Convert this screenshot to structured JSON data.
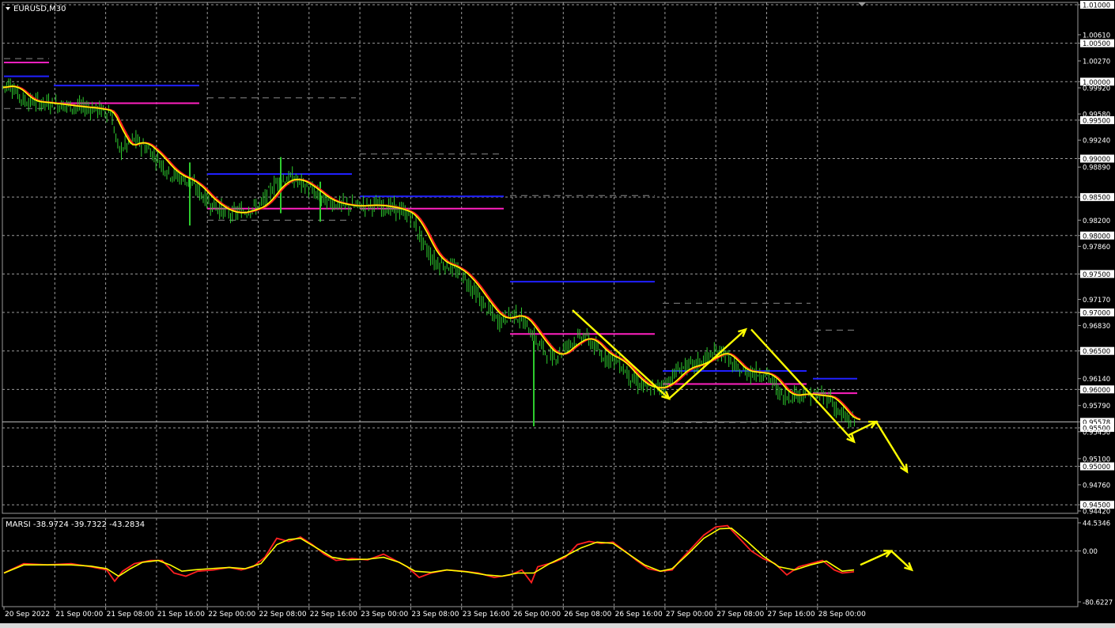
{
  "header": {
    "symbol_label": "EURUSD,M30"
  },
  "indicator": {
    "label": "MARSI -38.9724 -39.7322 -43.2834"
  },
  "colors": {
    "background": "#000000",
    "grid": "#9a9a9a",
    "candle": "#2ecc2e",
    "ma_fast": "#ff2020",
    "ma_slow": "#ffff00",
    "level_blue": "#2020ff",
    "level_magenta": "#ff20c0",
    "arrow": "#ffff00",
    "text": "#ffffff"
  },
  "chart_data": [
    {
      "type": "candlestick",
      "name": "EURUSD,M30",
      "ylim": [
        0.9442,
        1.01
      ],
      "x_ticks": [
        "20 Sep 2022",
        "21 Sep 00:00",
        "21 Sep 08:00",
        "21 Sep 16:00",
        "22 Sep 00:00",
        "22 Sep 08:00",
        "22 Sep 16:00",
        "23 Sep 00:00",
        "23 Sep 08:00",
        "23 Sep 16:00",
        "26 Sep 00:00",
        "26 Sep 08:00",
        "26 Sep 16:00",
        "27 Sep 00:00",
        "27 Sep 08:00",
        "27 Sep 16:00",
        "28 Sep 00:00"
      ],
      "y_ticks": [
        "1.01000",
        "1.00610",
        "1.00500",
        "1.00270",
        "1.00000",
        "0.99920",
        "0.99580",
        "0.99500",
        "0.99240",
        "0.99000",
        "0.98890",
        "0.98500",
        "0.98200",
        "0.98000",
        "0.97860",
        "0.97500",
        "0.97170",
        "0.97000",
        "0.96830",
        "0.96500",
        "0.96140",
        "0.96000",
        "0.95790",
        "0.95578",
        "0.95500",
        "0.95450",
        "0.95100",
        "0.95000",
        "0.94760",
        "0.94500",
        "0.94420"
      ],
      "current_price": 0.95578,
      "grid": true,
      "price_path": [
        [
          0,
          0.999
        ],
        [
          12,
          0.9998
        ],
        [
          30,
          0.9975
        ],
        [
          60,
          0.9972
        ],
        [
          90,
          0.9968
        ],
        [
          120,
          0.9965
        ],
        [
          140,
          0.996
        ],
        [
          150,
          0.991
        ],
        [
          170,
          0.9925
        ],
        [
          190,
          0.991
        ],
        [
          215,
          0.988
        ],
        [
          240,
          0.987
        ],
        [
          265,
          0.9842
        ],
        [
          290,
          0.9828
        ],
        [
          310,
          0.9832
        ],
        [
          330,
          0.984
        ],
        [
          350,
          0.987
        ],
        [
          370,
          0.9875
        ],
        [
          390,
          0.9862
        ],
        [
          410,
          0.9845
        ],
        [
          440,
          0.9838
        ],
        [
          470,
          0.984
        ],
        [
          500,
          0.9835
        ],
        [
          520,
          0.9825
        ],
        [
          535,
          0.979
        ],
        [
          550,
          0.9765
        ],
        [
          570,
          0.976
        ],
        [
          590,
          0.9742
        ],
        [
          610,
          0.9712
        ],
        [
          630,
          0.9688
        ],
        [
          650,
          0.97
        ],
        [
          665,
          0.9685
        ],
        [
          680,
          0.966
        ],
        [
          700,
          0.964
        ],
        [
          720,
          0.966
        ],
        [
          740,
          0.967
        ],
        [
          760,
          0.9645
        ],
        [
          780,
          0.9638
        ],
        [
          800,
          0.9612
        ],
        [
          820,
          0.96
        ],
        [
          840,
          0.9605
        ],
        [
          860,
          0.9628
        ],
        [
          880,
          0.9632
        ],
        [
          900,
          0.9645
        ],
        [
          915,
          0.965
        ],
        [
          930,
          0.9625
        ],
        [
          950,
          0.9622
        ],
        [
          970,
          0.962
        ],
        [
          990,
          0.959
        ],
        [
          1010,
          0.9595
        ],
        [
          1030,
          0.9592
        ],
        [
          1050,
          0.959
        ],
        [
          1060,
          0.957
        ],
        [
          1075,
          0.9558
        ],
        [
          1082,
          0.956
        ]
      ],
      "spikes": [
        [
          675,
          0.9663,
          0.9552
        ],
        [
          240,
          0.9895,
          0.9813
        ],
        [
          355,
          0.9902,
          0.9829
        ],
        [
          405,
          0.987,
          0.9818
        ]
      ],
      "levels": [
        {
          "color": "magenta",
          "y": 1.0025,
          "x": [
            5,
            62
          ]
        },
        {
          "color": "blue",
          "y": 1.0007,
          "x": [
            5,
            62
          ]
        },
        {
          "color": "blue",
          "y": 0.9995,
          "x": [
            68,
            252
          ]
        },
        {
          "color": "magenta",
          "y": 0.9972,
          "x": [
            68,
            252
          ]
        },
        {
          "color": "blue",
          "y": 0.988,
          "x": [
            262,
            445
          ]
        },
        {
          "color": "magenta",
          "y": 0.9835,
          "x": [
            262,
            445
          ]
        },
        {
          "color": "blue",
          "y": 0.9851,
          "x": [
            455,
            637
          ]
        },
        {
          "color": "magenta",
          "y": 0.9835,
          "x": [
            455,
            637
          ]
        },
        {
          "color": "blue",
          "y": 0.974,
          "x": [
            645,
            828
          ]
        },
        {
          "color": "magenta",
          "y": 0.9672,
          "x": [
            645,
            828
          ]
        },
        {
          "color": "blue",
          "y": 0.9624,
          "x": [
            838,
            1020
          ]
        },
        {
          "color": "magenta",
          "y": 0.9607,
          "x": [
            838,
            1020
          ]
        },
        {
          "color": "blue",
          "y": 0.9614,
          "x": [
            1028,
            1084
          ]
        },
        {
          "color": "magenta",
          "y": 0.9595,
          "x": [
            1028,
            1084
          ]
        }
      ],
      "dashed_levels": [
        {
          "y": 1.003,
          "x": [
            5,
            62
          ]
        },
        {
          "y": 0.9965,
          "x": [
            5,
            62
          ]
        },
        {
          "y": 0.9979,
          "x": [
            262,
            450
          ]
        },
        {
          "y": 0.9906,
          "x": [
            455,
            637
          ]
        },
        {
          "y": 0.982,
          "x": [
            262,
            445
          ]
        },
        {
          "y": 0.9852,
          "x": [
            645,
            828
          ]
        },
        {
          "y": 0.9712,
          "x": [
            838,
            1025
          ]
        },
        {
          "y": 0.9677,
          "x": [
            1030,
            1084
          ]
        },
        {
          "y": 0.9557,
          "x": [
            838,
            1025
          ]
        }
      ],
      "zigzag": [
        [
          724,
          0.9703
        ],
        [
          846,
          0.9588
        ],
        [
          943,
          0.9678
        ]
      ],
      "zigzag2": [
        [
          950,
          0.9678
        ],
        [
          1080,
          0.9532
        ]
      ],
      "forecast_arrow": [
        [
          1072,
          0.954
        ],
        [
          1108,
          0.9558
        ],
        [
          1147,
          0.9493
        ]
      ]
    },
    {
      "type": "line",
      "name": "MARSI",
      "ylim": [
        -80.6227,
        44.5346
      ],
      "y_ticks": [
        "44.5346",
        "0.00",
        "-80.6227"
      ],
      "path_a": [
        [
          5,
          -35
        ],
        [
          30,
          -20
        ],
        [
          60,
          -22
        ],
        [
          90,
          -20
        ],
        [
          115,
          -25
        ],
        [
          135,
          -30
        ],
        [
          145,
          -48
        ],
        [
          155,
          -32
        ],
        [
          170,
          -20
        ],
        [
          190,
          -15
        ],
        [
          205,
          -15
        ],
        [
          220,
          -35
        ],
        [
          235,
          -40
        ],
        [
          250,
          -32
        ],
        [
          270,
          -30
        ],
        [
          290,
          -26
        ],
        [
          305,
          -30
        ],
        [
          320,
          -25
        ],
        [
          335,
          -10
        ],
        [
          350,
          20
        ],
        [
          365,
          15
        ],
        [
          380,
          22
        ],
        [
          395,
          10
        ],
        [
          410,
          -5
        ],
        [
          425,
          -15
        ],
        [
          445,
          -12
        ],
        [
          465,
          -14
        ],
        [
          485,
          -5
        ],
        [
          500,
          -15
        ],
        [
          515,
          -25
        ],
        [
          530,
          -42
        ],
        [
          545,
          -35
        ],
        [
          565,
          -30
        ],
        [
          585,
          -32
        ],
        [
          605,
          -35
        ],
        [
          625,
          -42
        ],
        [
          645,
          -38
        ],
        [
          660,
          -30
        ],
        [
          672,
          -50
        ],
        [
          680,
          -25
        ],
        [
          700,
          -18
        ],
        [
          715,
          -10
        ],
        [
          730,
          10
        ],
        [
          745,
          15
        ],
        [
          760,
          12
        ],
        [
          775,
          14
        ],
        [
          790,
          0
        ],
        [
          805,
          -15
        ],
        [
          820,
          -28
        ],
        [
          835,
          -32
        ],
        [
          850,
          -30
        ],
        [
          860,
          -15
        ],
        [
          875,
          5
        ],
        [
          890,
          25
        ],
        [
          905,
          38
        ],
        [
          920,
          40
        ],
        [
          935,
          20
        ],
        [
          950,
          0
        ],
        [
          965,
          -12
        ],
        [
          980,
          -20
        ],
        [
          995,
          -38
        ],
        [
          1010,
          -25
        ],
        [
          1025,
          -20
        ],
        [
          1040,
          -15
        ],
        [
          1055,
          -30
        ],
        [
          1065,
          -35
        ],
        [
          1080,
          -33
        ]
      ],
      "path_b": [
        [
          5,
          -35
        ],
        [
          30,
          -22
        ],
        [
          60,
          -22
        ],
        [
          90,
          -22
        ],
        [
          115,
          -24
        ],
        [
          135,
          -28
        ],
        [
          150,
          -40
        ],
        [
          165,
          -28
        ],
        [
          180,
          -18
        ],
        [
          200,
          -15
        ],
        [
          215,
          -22
        ],
        [
          230,
          -32
        ],
        [
          245,
          -30
        ],
        [
          265,
          -28
        ],
        [
          290,
          -26
        ],
        [
          310,
          -28
        ],
        [
          330,
          -20
        ],
        [
          350,
          10
        ],
        [
          365,
          18
        ],
        [
          380,
          20
        ],
        [
          400,
          5
        ],
        [
          420,
          -10
        ],
        [
          440,
          -14
        ],
        [
          465,
          -13
        ],
        [
          485,
          -10
        ],
        [
          505,
          -18
        ],
        [
          525,
          -32
        ],
        [
          545,
          -34
        ],
        [
          565,
          -30
        ],
        [
          590,
          -33
        ],
        [
          615,
          -38
        ],
        [
          635,
          -40
        ],
        [
          655,
          -35
        ],
        [
          675,
          -35
        ],
        [
          695,
          -20
        ],
        [
          715,
          -8
        ],
        [
          735,
          5
        ],
        [
          755,
          14
        ],
        [
          775,
          12
        ],
        [
          795,
          -5
        ],
        [
          815,
          -22
        ],
        [
          835,
          -32
        ],
        [
          850,
          -28
        ],
        [
          870,
          -5
        ],
        [
          890,
          20
        ],
        [
          910,
          35
        ],
        [
          925,
          36
        ],
        [
          945,
          15
        ],
        [
          965,
          -8
        ],
        [
          985,
          -25
        ],
        [
          1005,
          -30
        ],
        [
          1025,
          -22
        ],
        [
          1045,
          -16
        ],
        [
          1065,
          -32
        ],
        [
          1080,
          -30
        ]
      ],
      "forecast_arrow": [
        [
          1088,
          -22
        ],
        [
          1127,
          0
        ],
        [
          1153,
          -30
        ]
      ]
    }
  ]
}
